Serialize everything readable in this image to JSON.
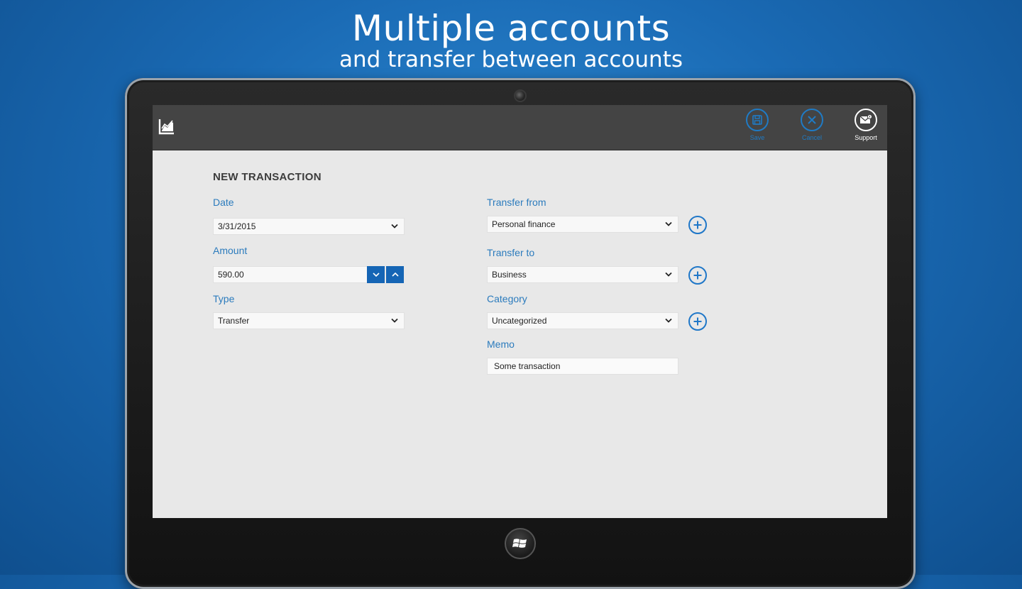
{
  "hero": {
    "title": "Multiple accounts",
    "subtitle": "and transfer between accounts"
  },
  "appbar": {
    "logo_icon": "chart-icon",
    "commands": [
      {
        "label": "Save",
        "icon": "save-icon",
        "enabled": false
      },
      {
        "label": "Cancel",
        "icon": "close-icon",
        "enabled": false
      },
      {
        "label": "Support",
        "icon": "mail-icon",
        "enabled": true
      }
    ]
  },
  "page": {
    "title": "NEW TRANSACTION"
  },
  "form": {
    "date": {
      "label": "Date",
      "value": "3/31/2015"
    },
    "amount": {
      "label": "Amount",
      "value": "590.00"
    },
    "type": {
      "label": "Type",
      "value": "Transfer"
    },
    "transfer_from": {
      "label": "Transfer from",
      "value": "Personal finance"
    },
    "transfer_to": {
      "label": "Transfer to",
      "value": "Business"
    },
    "category": {
      "label": "Category",
      "value": "Uncategorized"
    },
    "memo": {
      "label": "Memo",
      "value": "Some transaction"
    }
  },
  "colors": {
    "accent": "#2b7bbd",
    "appbar": "#444444",
    "spinner": "#1565b5",
    "background_blue": "#1a6ab4"
  }
}
